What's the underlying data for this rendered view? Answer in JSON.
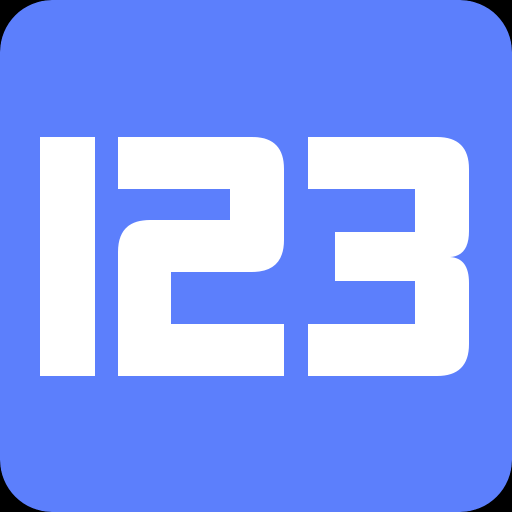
{
  "app_icon": {
    "label": "123",
    "colors": {
      "background": "#5C7FFC",
      "glyph": "#FFFFFF",
      "outer": "#000000"
    }
  }
}
